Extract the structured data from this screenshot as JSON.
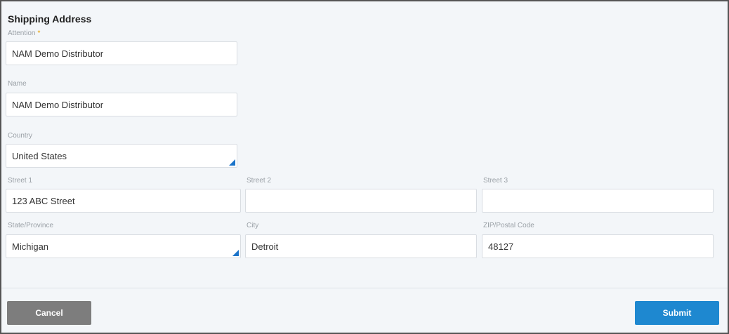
{
  "form": {
    "title": "Shipping Address",
    "required_marker": "*",
    "attention": {
      "label": "Attention",
      "value": "NAM Demo Distributor"
    },
    "name": {
      "label": "Name",
      "value": "NAM Demo Distributor"
    },
    "country": {
      "label": "Country",
      "value": "United States"
    },
    "street1": {
      "label": "Street 1",
      "value": "123 ABC Street"
    },
    "street2": {
      "label": "Street 2",
      "value": ""
    },
    "street3": {
      "label": "Street 3",
      "value": ""
    },
    "state": {
      "label": "State/Province",
      "value": "Michigan"
    },
    "city": {
      "label": "City",
      "value": "Detroit"
    },
    "zip": {
      "label": "ZIP/Postal Code",
      "value": "48127"
    }
  },
  "footer": {
    "cancel_label": "Cancel",
    "submit_label": "Submit"
  },
  "colors": {
    "accent": "#1e88d0",
    "cancel": "#7d7d7d",
    "required": "#e8a000"
  }
}
